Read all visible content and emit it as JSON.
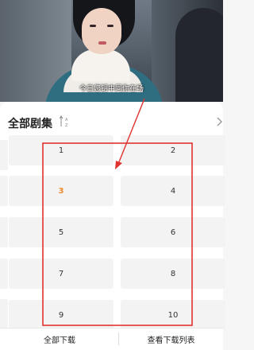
{
  "video": {
    "subtitle": "今日您钥中同你在场"
  },
  "episodes": {
    "title": "全部剧集",
    "sort_icon": "sort-az-icon",
    "more_icon": "chevron-right-icon",
    "items": [
      {
        "label": "1",
        "active": false
      },
      {
        "label": "2",
        "active": false
      },
      {
        "label": "3",
        "active": true
      },
      {
        "label": "4",
        "active": false
      },
      {
        "label": "5",
        "active": false
      },
      {
        "label": "6",
        "active": false
      },
      {
        "label": "7",
        "active": false
      },
      {
        "label": "8",
        "active": false
      },
      {
        "label": "9",
        "active": false
      },
      {
        "label": "10",
        "active": false
      }
    ]
  },
  "bottom": {
    "download_all": "全部下载",
    "view_list": "查看下载列表"
  },
  "colors": {
    "active_episode": "#ef8a2b",
    "annotation": "#e0332f"
  }
}
